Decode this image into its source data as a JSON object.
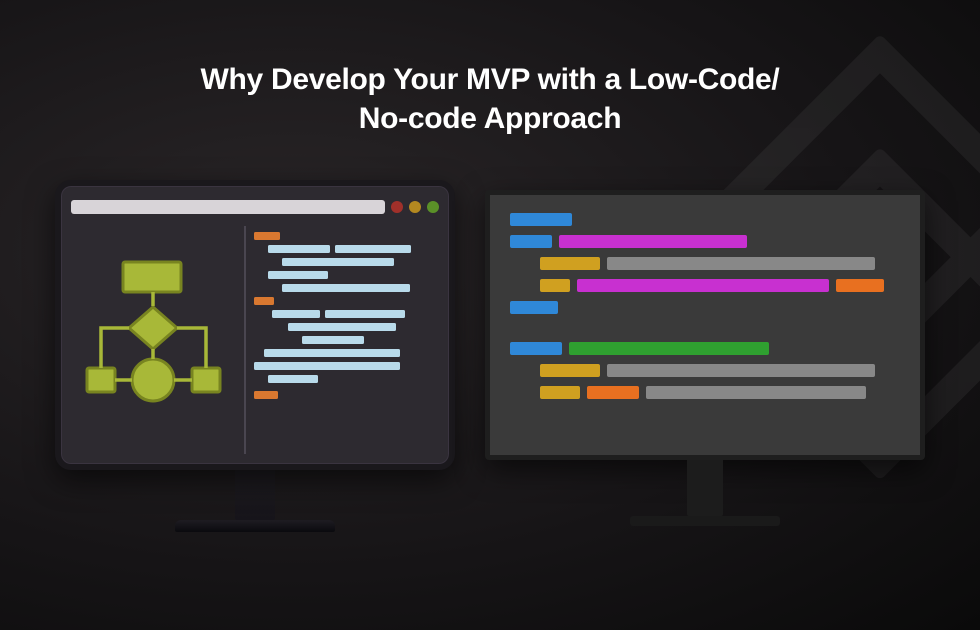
{
  "title_line1": "Why Develop Your MVP with a Low-Code/",
  "title_line2": "No-code Approach",
  "colors": {
    "flowchart_fill": "#a8b838",
    "flowchart_stroke": "#788420",
    "code1_accent": "#d97830",
    "code1_main": "#b8daea",
    "code2_blue": "#2f88d8",
    "code2_magenta": "#c830d0",
    "code2_gray": "#888888",
    "code2_yellow": "#d0a020",
    "code2_orange": "#e87020",
    "code2_green": "#2fa030"
  }
}
